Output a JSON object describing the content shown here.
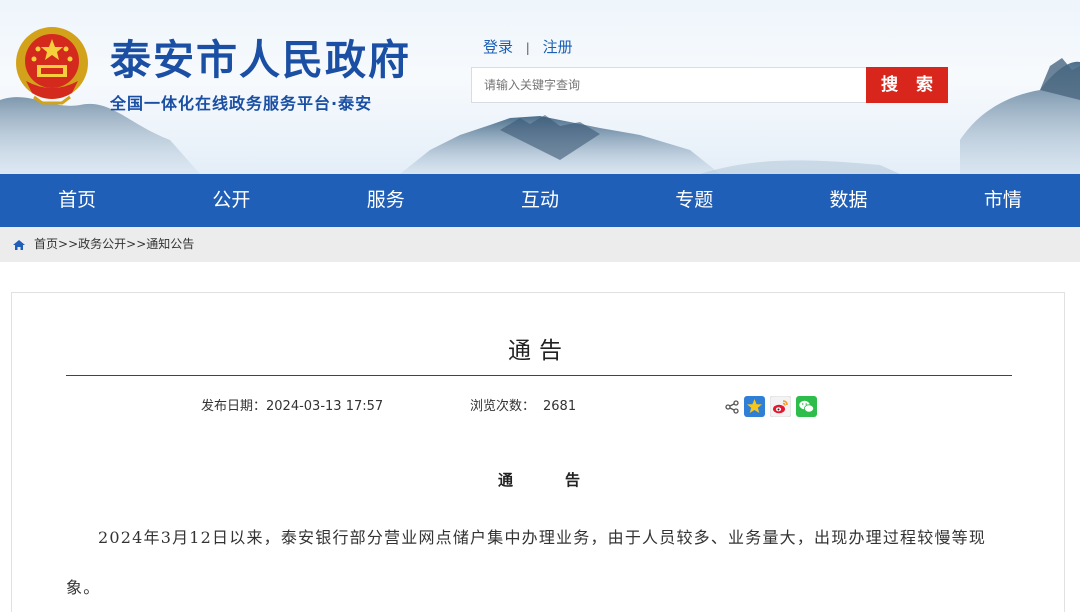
{
  "header": {
    "title": "泰安市人民政府",
    "subtitle": "全国一体化在线政务服务平台·泰安",
    "login": "登录",
    "register": "注册",
    "search_placeholder": "请输入关键字查询",
    "search_button": "搜 索"
  },
  "nav": {
    "items": [
      "首页",
      "公开",
      "服务",
      "互动",
      "专题",
      "数据",
      "市情"
    ]
  },
  "breadcrumb": {
    "home": "首页",
    "sep1": ">>",
    "level2": "政务公开",
    "sep2": ">>",
    "level3": "通知公告"
  },
  "article": {
    "title": "通告",
    "date_label": "发布日期：",
    "date_value": "2024-03-13 17:57",
    "views_label": "浏览次数：",
    "views_value": "2681",
    "share_icons": [
      "share-icon",
      "star-icon",
      "weibo-icon",
      "wechat-icon"
    ],
    "body_heading_1": "通",
    "body_heading_2": "告",
    "paragraph": "2024年3月12日以来，泰安银行部分营业网点储户集中办理业务，由于人员较多、业务量大，出现办理过程较慢等现象。"
  },
  "colors": {
    "brand_blue": "#1f5fb7",
    "title_blue": "#1a4fa3",
    "search_red": "#d9261c"
  }
}
